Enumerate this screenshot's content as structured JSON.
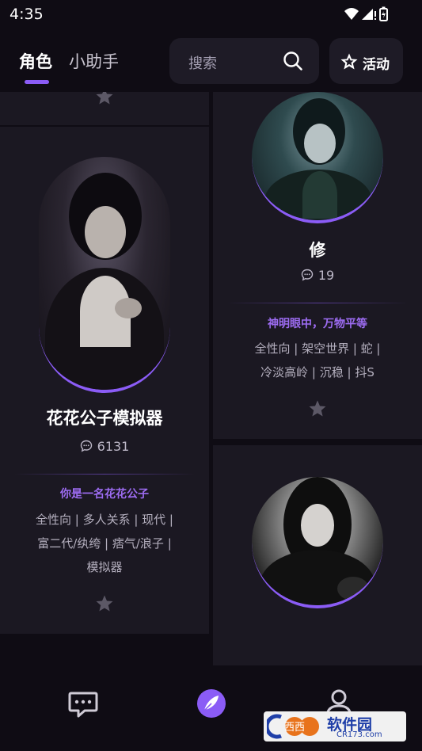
{
  "status_bar": {
    "time": "4:35"
  },
  "header": {
    "tabs": [
      {
        "label": "角色",
        "active": true
      },
      {
        "label": "小助手",
        "active": false
      }
    ],
    "search": {
      "placeholder": "搜索"
    },
    "activity_button": {
      "label": "活动"
    }
  },
  "characters": [
    {
      "name": "花花公子模拟器",
      "chat_count": "6131",
      "tagline": "你是一名花花公子",
      "tags_line1": "全性向 | 多人关系 | 现代 |",
      "tags_line2": "富二代/纨绔 | 痞气/浪子 |",
      "tags_line3": "模拟器"
    },
    {
      "name": "修",
      "chat_count": "19",
      "tagline": "神明眼中，万物平等",
      "tags_line1": "全性向 | 架空世界 | 蛇 |",
      "tags_line2": "冷淡高岭 | 沉稳 | 抖S"
    }
  ],
  "watermark": {
    "text": "软件园",
    "sub": "CR173.com",
    "logo_text": "西西"
  },
  "colors": {
    "background": "#0f0c14",
    "card": "#1b1822",
    "accent": "#8b5cf6",
    "tagline": "#9d6cf2"
  }
}
